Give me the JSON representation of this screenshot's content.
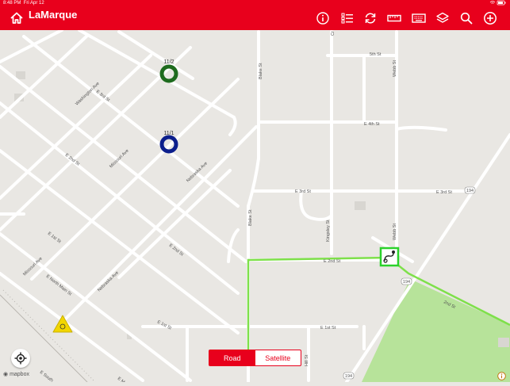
{
  "status_bar": {
    "time": "8:48 PM",
    "date": "Fri Apr 12"
  },
  "header": {
    "title": "LaMarque",
    "colors": {
      "bar": "#e8001c",
      "icons": "#ffffff"
    },
    "icons": [
      "home-icon",
      "info-icon",
      "list-icon",
      "refresh-icon",
      "ruler-icon",
      "keyboard-icon",
      "layers-icon",
      "search-icon",
      "add-icon"
    ]
  },
  "map": {
    "streets": {
      "fifth": "5th St",
      "fourth": "E 4th St",
      "third": "E 3rd St",
      "third_west": "E 3rd St",
      "second": "E 2nd St",
      "second_west": "E 2nd St",
      "second_diag": "2nd St",
      "second_nw": "E 2nd St",
      "first": "E 1st St",
      "first_west": "E 1st St",
      "first_nw": "E 1st St",
      "blake": "Blake St",
      "blake_south": "Blake St",
      "kingsley": "Kingsley St",
      "webb_north": "Webb St",
      "webb_south": "Webb St",
      "hill": "Hill St",
      "washington": "Washington Ave",
      "missouri": "Missouri Ave",
      "missouri_south": "Missouri Ave",
      "nebraska": "Nebraska Ave",
      "nebraska_south": "Nebraska Ave",
      "north_main": "E North Main St",
      "e3rd_nw": "E 3rd St",
      "e_south": "E South",
      "cr": "Cr",
      "e_m": "E M",
      "shield_1": "194",
      "shield_2": "194",
      "shield_3": "194"
    },
    "markers": [
      {
        "label": "11/2",
        "color": "#1e6b1e",
        "kind": "stop"
      },
      {
        "label": "11/1",
        "color": "#0c1f8c",
        "kind": "stop"
      },
      {
        "label": "",
        "color": "#f2d600",
        "kind": "warning"
      },
      {
        "label": "",
        "color": "#2bd12b",
        "kind": "route-end"
      }
    ],
    "route_color": "#7ee04a",
    "park_color": "#b7e39a"
  },
  "view_toggle": {
    "road": "Road",
    "satellite": "Satellite",
    "selected": "Road"
  },
  "attribution": {
    "logo": "mapbox"
  },
  "locate": {
    "icon": "locate-icon"
  }
}
